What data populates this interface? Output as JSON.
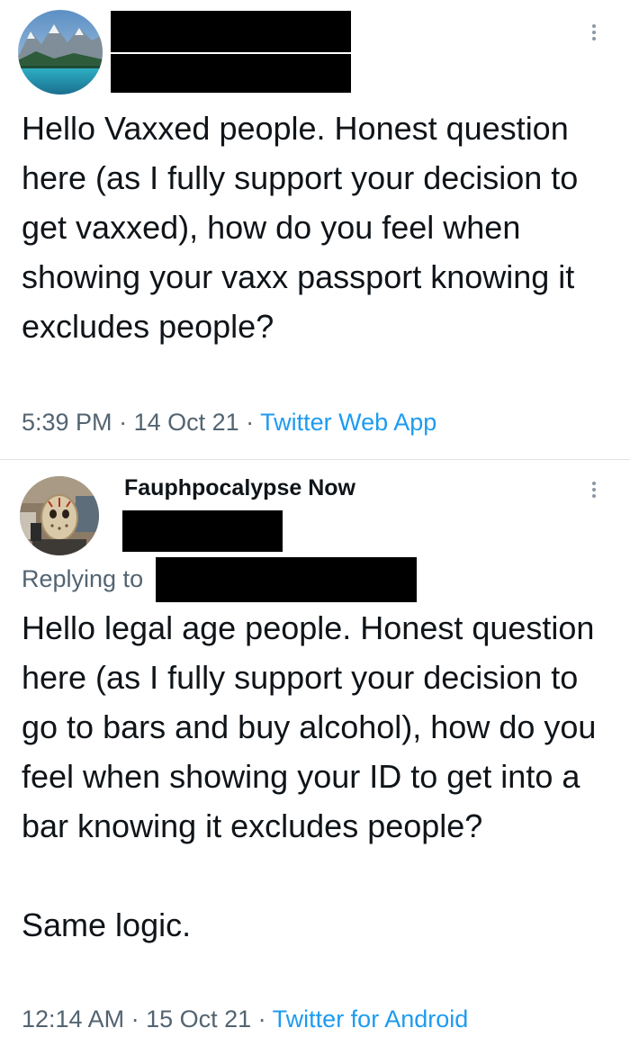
{
  "tweet1": {
    "avatar_icon": "landscape-avatar-icon",
    "text": "Hello Vaxxed people. Honest question here (as I fully support your decision to get vaxxed), how do you feel when showing your vaxx passport knowing it excludes people?",
    "time": "5:39 PM",
    "date": "14 Oct 21",
    "source": "Twitter Web App",
    "separator": " · "
  },
  "tweet2": {
    "avatar_icon": "masked-person-avatar-icon",
    "display_name": "Fauphpocalypse Now",
    "replying_label": "Replying to",
    "text": "Hello legal age people. Honest question here (as I fully support your decision to go to bars and buy alcohol), how do you feel when showing your ID to get into a bar knowing it excludes people?\n\nSame logic.",
    "time": "12:14 AM",
    "date": "15 Oct 21",
    "source": "Twitter for Android",
    "separator": " · "
  },
  "colors": {
    "text": "#0f1419",
    "secondary": "#536471",
    "link": "#1d9bf0",
    "redaction": "#000000"
  }
}
